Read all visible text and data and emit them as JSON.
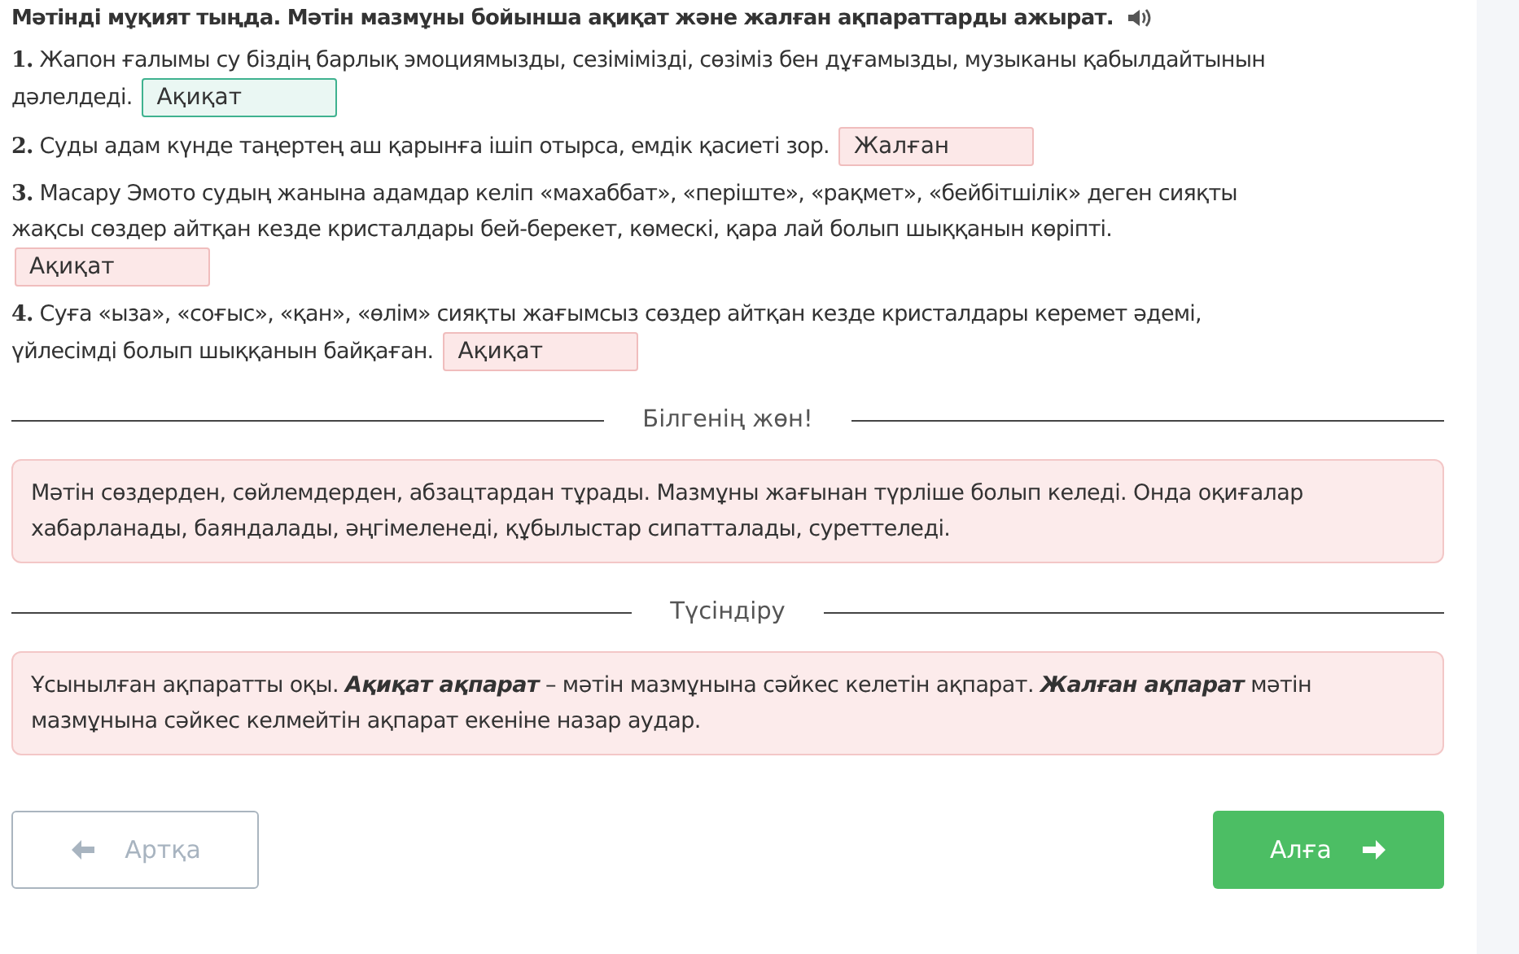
{
  "title": "Мәтінді мұқият тыңда. Мәтін мазмұны бойынша ақиқат және жалған ақпараттарды ажырат.",
  "questions": [
    {
      "number": "1.",
      "lines": [
        "Жапон ғалымы су біздің барлық эмоциямызды, сезімімізді, сөзіміз бен дұғамызды, музыканы қабылдайтынын",
        "дәлелдеді."
      ],
      "answer": "Ақиқат",
      "correct": true
    },
    {
      "number": "2.",
      "lines": [
        "Суды адам күнде таңертең аш қарынға ішіп отырса, емдік қасиеті зор."
      ],
      "answer": "Жалған",
      "correct": false
    },
    {
      "number": "3.",
      "lines": [
        "Масару Эмото судың жанына адамдар келіп «махаббат», «періште», «рақмет», «бейбітшілік» деген сияқты",
        "жақсы сөздер айтқан кезде кристалдары бей-берекет, көмескі, қара лай болып шыққанын көріпті."
      ],
      "answer": "Ақиқат",
      "answer_below": true,
      "correct": false
    },
    {
      "number": "4.",
      "lines": [
        "Суға «ыза», «соғыс», «қан», «өлім» сияқты жағымсыз сөздер айтқан кезде кристалдары керемет әдемі,",
        "үйлесімді болып шыққанын байқаған."
      ],
      "answer": "Ақиқат",
      "correct": false
    }
  ],
  "sections": [
    {
      "heading": "Білгенің жөн!",
      "text": "Мәтін сөздерден, сөйлемдерден, абзацтардан тұрады. Мазмұны жағынан түрліше болып келеді. Онда оқиғалар хабарланады, баяндалады, әңгімеленеді, құбылыстар сипатталады, суреттеледі."
    },
    {
      "heading": "Түсіндіру",
      "text": "Ұсынылған ақпаратты оқы. **Ақиқат ақпарат** – мәтін мазмұнына сәйкес келетін ақпарат. **Жалған ақпарат** мәтін мазмұнына сәйкес келмейтін ақпарат екеніне назар аудар."
    }
  ],
  "buttons": {
    "back": "Артқа",
    "next": "Алға"
  }
}
